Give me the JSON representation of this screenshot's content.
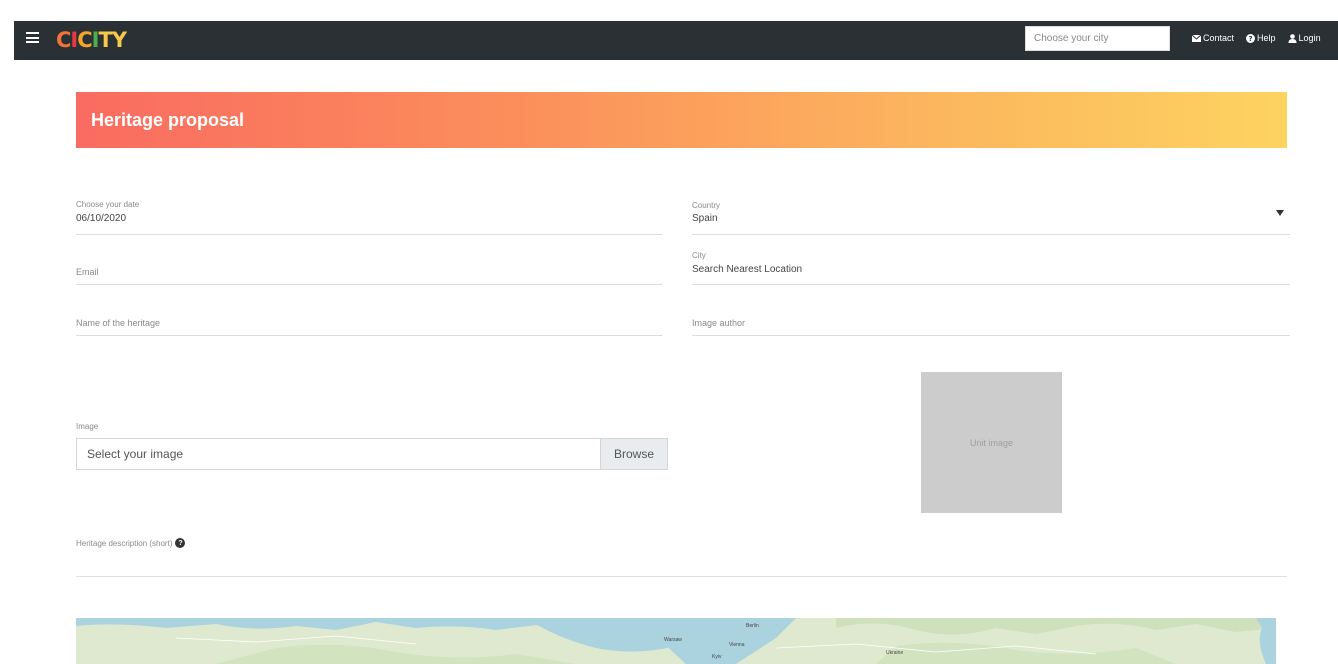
{
  "header": {
    "logo": {
      "letters": [
        "C",
        "I",
        "C",
        "I",
        "TY"
      ],
      "alt": "CCITY"
    },
    "city_search": {
      "placeholder": "Choose your city",
      "value": ""
    },
    "nav": [
      {
        "label": "Contact",
        "icon": "envelope-icon"
      },
      {
        "label": "Help",
        "icon": "question-circle-icon"
      },
      {
        "label": "Login",
        "icon": "user-icon"
      }
    ]
  },
  "banner": {
    "title": "Heritage proposal",
    "gradient": [
      "#fa6b61",
      "#fdd360"
    ]
  },
  "form": {
    "date": {
      "label": "Choose your date",
      "value": "06/10/2020"
    },
    "country": {
      "label": "Country",
      "value": "Spain"
    },
    "email": {
      "placeholder": "Email"
    },
    "city": {
      "label": "City",
      "value": "Search Nearest Location"
    },
    "heritage_name": {
      "placeholder": "Name of the heritage"
    },
    "image_author": {
      "placeholder": "Image author"
    },
    "image": {
      "label": "Image",
      "placeholder": "Select your image",
      "browse_label": "Browse"
    },
    "preview": {
      "text": "Unit image"
    },
    "description": {
      "label": "Heritage description (short)"
    }
  },
  "map": {
    "labels": [
      "Warsaw",
      "Berlin",
      "Vienna",
      "Kyiv",
      "Ukraine"
    ]
  },
  "colors": {
    "topbar": "#2b3035",
    "preview_bg": "#cccccc"
  }
}
